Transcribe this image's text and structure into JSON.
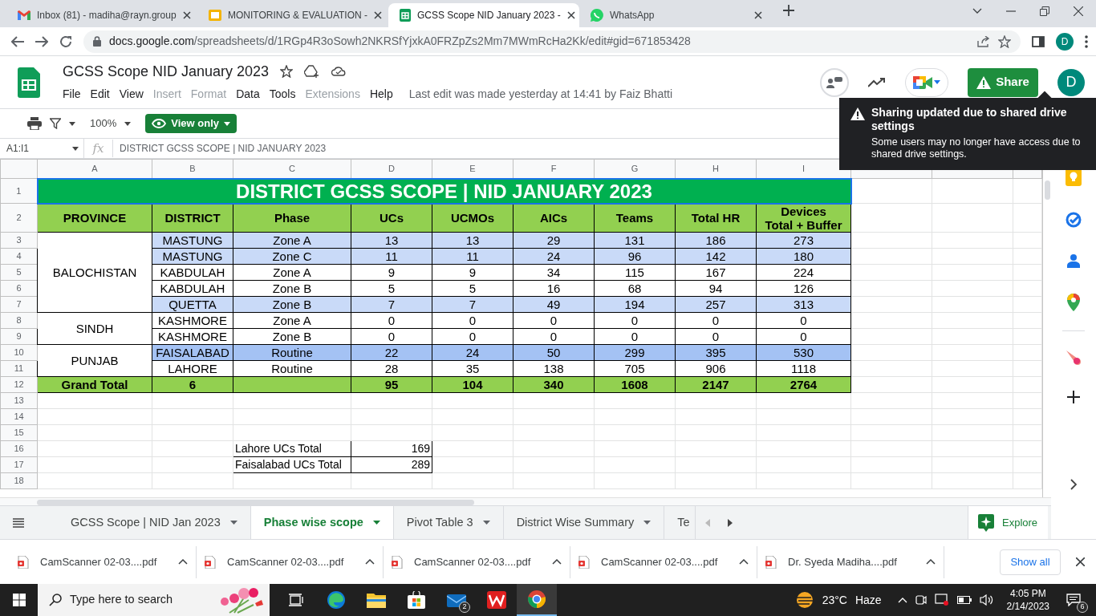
{
  "browser_tabs": [
    {
      "title": "Inbox (81) - madiha@rayn.group",
      "kind": "gmail",
      "selected": false
    },
    {
      "title": "MONITORING & EVALUATION -",
      "kind": "slides",
      "selected": false
    },
    {
      "title": "GCSS Scope NID January 2023 -",
      "kind": "sheets",
      "selected": true
    },
    {
      "title": "WhatsApp",
      "kind": "whatsapp",
      "selected": false
    }
  ],
  "address_bar": {
    "host": "docs.google.com",
    "path": "/spreadsheets/d/1RGp4R3oSowh2NKRSfYjxkA0FRZpZs2Mm7MWmRcHa2Kk/edit#gid=671853428",
    "profile": "D"
  },
  "document": {
    "title": "GCSS Scope NID January 2023",
    "menus": [
      {
        "label": "File",
        "disabled": false
      },
      {
        "label": "Edit",
        "disabled": false
      },
      {
        "label": "View",
        "disabled": false
      },
      {
        "label": "Insert",
        "disabled": true
      },
      {
        "label": "Format",
        "disabled": true
      },
      {
        "label": "Data",
        "disabled": false
      },
      {
        "label": "Tools",
        "disabled": false
      },
      {
        "label": "Extensions",
        "disabled": true
      },
      {
        "label": "Help",
        "disabled": false
      }
    ],
    "last_edit": "Last edit was made yesterday at 14:41 by Faiz Bhatti",
    "share": "Share",
    "avatar": "D"
  },
  "toast": {
    "title": "Sharing updated due to shared drive settings",
    "body": "Some users may no longer have access due to shared drive settings."
  },
  "toolbar": {
    "zoom": "100%",
    "view_mode": "View only"
  },
  "formula_bar": {
    "cell_ref": "A1:I1",
    "fx": "fx",
    "content": "DISTRICT GCSS SCOPE | NID JANUARY 2023"
  },
  "grid": {
    "columns": [
      "A",
      "B",
      "C",
      "D",
      "E",
      "F",
      "G",
      "H",
      "I"
    ],
    "rows": [
      "1",
      "2",
      "3",
      "4",
      "5",
      "6",
      "7",
      "8",
      "9",
      "10",
      "11",
      "12",
      "13",
      "14",
      "15",
      "16",
      "17",
      "18"
    ]
  },
  "sheet": {
    "title": "DISTRICT GCSS SCOPE | NID JANUARY 2023",
    "headers": [
      "PROVINCE",
      "DISTRICT",
      "Phase",
      "UCs",
      "UCMOs",
      "AICs",
      "Teams",
      "Total HR",
      "Devices\nTotal + Buffer"
    ],
    "provinces": [
      {
        "name": "BALOCHISTAN",
        "rows": [
          {
            "district": "MASTUNG",
            "phase": "Zone A",
            "values": [
              "13",
              "13",
              "29",
              "131",
              "186",
              "273"
            ],
            "color": "#c9daf8"
          },
          {
            "district": "MASTUNG",
            "phase": "Zone C",
            "values": [
              "11",
              "11",
              "24",
              "96",
              "142",
              "180"
            ],
            "color": "#c9daf8"
          },
          {
            "district": "KABDULAH",
            "phase": "Zone A",
            "values": [
              "9",
              "9",
              "34",
              "115",
              "167",
              "224"
            ]
          },
          {
            "district": "KABDULAH",
            "phase": "Zone B",
            "values": [
              "5",
              "5",
              "16",
              "68",
              "94",
              "126"
            ]
          },
          {
            "district": "QUETTA",
            "phase": "Zone B",
            "values": [
              "7",
              "7",
              "49",
              "194",
              "257",
              "313"
            ],
            "color": "#c9daf8"
          }
        ]
      },
      {
        "name": "SINDH",
        "rows": [
          {
            "district": "KASHMORE",
            "phase": "Zone A",
            "values": [
              "0",
              "0",
              "0",
              "0",
              "0",
              "0"
            ]
          },
          {
            "district": "KASHMORE",
            "phase": "Zone B",
            "values": [
              "0",
              "0",
              "0",
              "0",
              "0",
              "0"
            ]
          }
        ]
      },
      {
        "name": "PUNJAB",
        "rows": [
          {
            "district": "FAISALABAD",
            "phase": "Routine",
            "values": [
              "22",
              "24",
              "50",
              "299",
              "395",
              "530"
            ],
            "color": "#a4c2f4"
          },
          {
            "district": "LAHORE",
            "phase": "Routine",
            "values": [
              "28",
              "35",
              "138",
              "705",
              "906",
              "1118"
            ]
          }
        ]
      }
    ],
    "grand_total": {
      "label": "Grand Total",
      "districts": "6",
      "values": [
        "95",
        "104",
        "340",
        "1608",
        "2147",
        "2764"
      ]
    },
    "summary": [
      {
        "label": "Lahore UCs Total",
        "value": "169"
      },
      {
        "label": "Faisalabad UCs Total",
        "value": "289"
      }
    ]
  },
  "sheet_tabs": [
    {
      "label": "GCSS Scope | NID Jan 2023",
      "selected": false
    },
    {
      "label": "Phase wise scope",
      "selected": true
    },
    {
      "label": "Pivot Table 3",
      "selected": false
    },
    {
      "label": "District Wise Summary",
      "selected": false
    },
    {
      "label": "Te",
      "selected": false
    }
  ],
  "explore": "Explore",
  "downloads": {
    "files": [
      "CamScanner 02-03....pdf",
      "CamScanner 02-03....pdf",
      "CamScanner 02-03....pdf",
      "CamScanner 02-03....pdf",
      "Dr. Syeda Madiha....pdf"
    ],
    "show_all": "Show all"
  },
  "taskbar": {
    "search_placeholder": "Type here to search",
    "mail_badge": "2",
    "temperature": "23°C",
    "weather": "Haze",
    "time": "4:05 PM",
    "date": "2/14/2023",
    "notifications": "6"
  }
}
